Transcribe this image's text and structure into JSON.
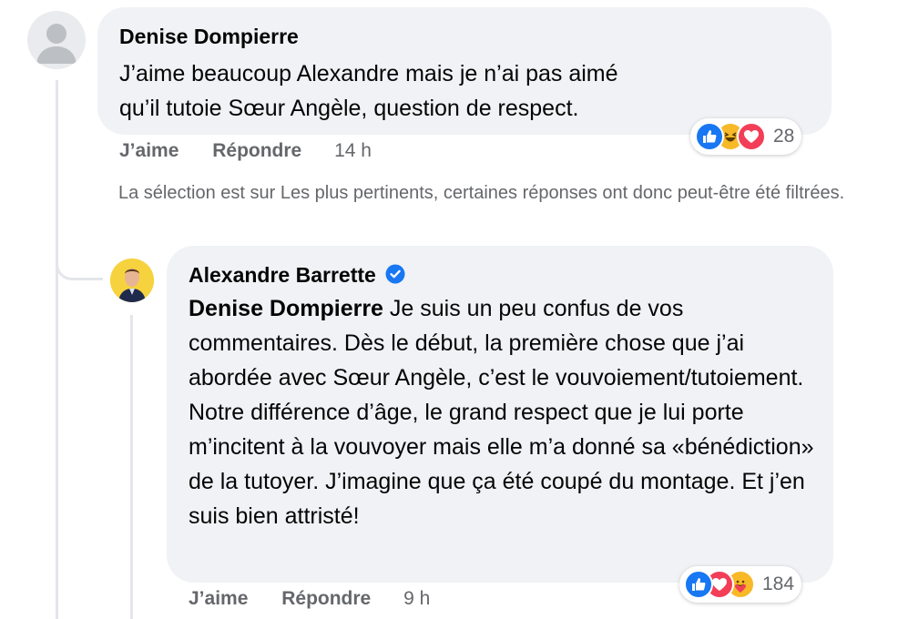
{
  "comment": {
    "author": "Denise Dompierre",
    "text": "J’aime beaucoup Alexandre mais je n’ai pas aimé qu’il tutoie Sœur Angèle, question de respect.",
    "like_label": "J’aime",
    "reply_label": "Répondre",
    "time": "14 h",
    "reactions": {
      "icons": [
        "like-icon",
        "haha-icon",
        "love-icon"
      ],
      "count": "28"
    }
  },
  "filter_notice": "La sélection est sur Les plus pertinents, certaines réponses ont donc peut-être été filtrées.",
  "reply": {
    "author": "Alexandre Barrette",
    "verified": true,
    "mention": "Denise Dompierre",
    "text": " Je suis un peu confus de vos commentaires. Dès le début, la première chose que j’ai abordée avec Sœur Angèle, c’est le vouvoiement/tutoiement. Notre différence d’âge, le grand respect que je lui porte m’incitent à la vouvoyer mais elle m’a donné sa «bénédiction» de la tutoyer. J’imagine que ça été coupé du montage. Et j’en suis bien attristé!",
    "like_label": "J’aime",
    "reply_label": "Répondre",
    "time": "9 h",
    "reactions": {
      "icons": [
        "like-icon",
        "love-icon",
        "care-icon"
      ],
      "count": "184"
    }
  },
  "colors": {
    "bubble": "#f0f2f5",
    "secondary_text": "#65676b",
    "verified": "#1877f2",
    "avatar_bg": "#f6d23e"
  }
}
